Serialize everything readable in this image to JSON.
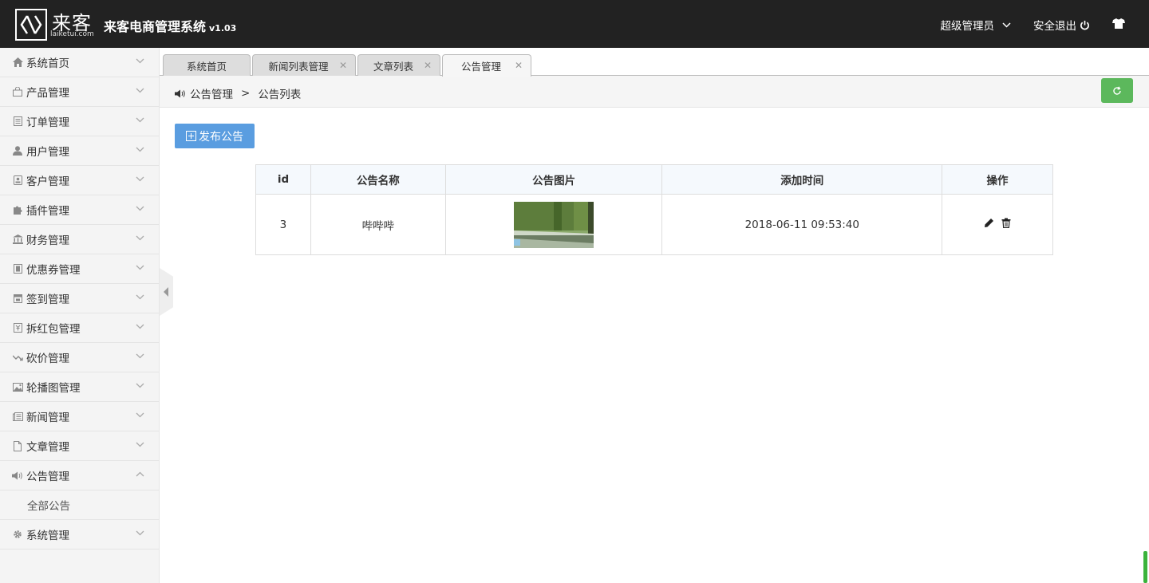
{
  "header": {
    "logo_cn": "来客",
    "logo_en": "laiketui.com",
    "title": "来客电商管理系统",
    "version": "v1.03",
    "user": "超级管理员",
    "logout": "安全退出"
  },
  "sidebar": {
    "items": [
      {
        "label": "系统首页",
        "icon": "home-icon"
      },
      {
        "label": "产品管理",
        "icon": "shopping-bag-icon"
      },
      {
        "label": "订单管理",
        "icon": "order-list-icon"
      },
      {
        "label": "用户管理",
        "icon": "user-icon"
      },
      {
        "label": "客户管理",
        "icon": "customer-icon"
      },
      {
        "label": "插件管理",
        "icon": "puzzle-icon"
      },
      {
        "label": "财务管理",
        "icon": "bank-icon"
      },
      {
        "label": "优惠券管理",
        "icon": "coupon-icon"
      },
      {
        "label": "签到管理",
        "icon": "calendar-icon"
      },
      {
        "label": "拆红包管理",
        "icon": "red-packet-icon"
      },
      {
        "label": "砍价管理",
        "icon": "trend-icon"
      },
      {
        "label": "轮播图管理",
        "icon": "image-icon"
      },
      {
        "label": "新闻管理",
        "icon": "newspaper-icon"
      },
      {
        "label": "文章管理",
        "icon": "file-icon"
      },
      {
        "label": "公告管理",
        "icon": "speaker-icon"
      },
      {
        "label": "系统管理",
        "icon": "gear-icon"
      }
    ],
    "submenu": {
      "label": "全部公告"
    }
  },
  "tabs": [
    {
      "label": "系统首页"
    },
    {
      "label": "新闻列表管理"
    },
    {
      "label": "文章列表"
    },
    {
      "label": "公告管理"
    }
  ],
  "breadcrumb": {
    "section": "公告管理",
    "separator": ">",
    "page": "公告列表"
  },
  "publish_button": "发布公告",
  "table": {
    "columns": [
      "id",
      "公告名称",
      "公告图片",
      "添加时间",
      "操作"
    ],
    "rows": [
      {
        "id": "3",
        "name": "哔哔哔",
        "time": "2018-06-11 09:53:40"
      }
    ]
  },
  "colors": {
    "header_bg": "#222222",
    "refresh_green": "#5cb85c",
    "publish_blue": "#5a9de0"
  }
}
